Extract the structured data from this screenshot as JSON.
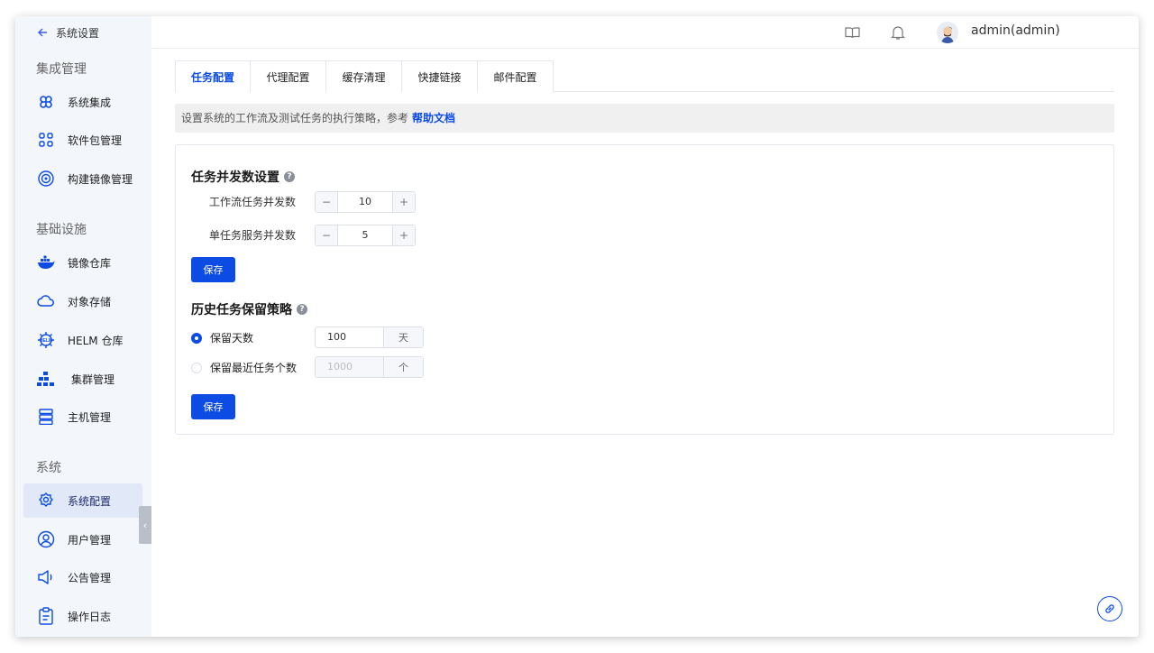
{
  "sidebar": {
    "back_label": "系统设置",
    "groups": [
      {
        "title": "集成管理",
        "items": [
          {
            "label": "系统集成",
            "icon": "command-icon"
          },
          {
            "label": "软件包管理",
            "icon": "grid-icon"
          },
          {
            "label": "构建镜像管理",
            "icon": "target-icon"
          }
        ]
      },
      {
        "title": "基础设施",
        "items": [
          {
            "label": "镜像仓库",
            "icon": "docker-icon"
          },
          {
            "label": "对象存储",
            "icon": "cloud-icon"
          },
          {
            "label": "HELM 仓库",
            "icon": "helm-icon"
          },
          {
            "label": "集群管理",
            "icon": "cluster-icon"
          },
          {
            "label": "主机管理",
            "icon": "server-icon"
          }
        ]
      },
      {
        "title": "系统",
        "items": [
          {
            "label": "系统配置",
            "icon": "settings-icon",
            "active": true
          },
          {
            "label": "用户管理",
            "icon": "user-icon"
          },
          {
            "label": "公告管理",
            "icon": "speaker-icon"
          },
          {
            "label": "操作日志",
            "icon": "clipboard-icon"
          }
        ]
      }
    ]
  },
  "header": {
    "username": "admin(admin)"
  },
  "tabs": [
    {
      "label": "任务配置",
      "active": true
    },
    {
      "label": "代理配置"
    },
    {
      "label": "缓存清理"
    },
    {
      "label": "快捷链接"
    },
    {
      "label": "邮件配置"
    }
  ],
  "info": {
    "text": "设置系统的工作流及测试任务的执行策略，参考",
    "link": "帮助文档"
  },
  "concurrency": {
    "title": "任务并发数设置",
    "workflow_label": "工作流任务并发数",
    "workflow_value": "10",
    "service_label": "单任务服务并发数",
    "service_value": "5",
    "save_label": "保存"
  },
  "retention": {
    "title": "历史任务保留策略",
    "days_label": "保留天数",
    "days_value": "100",
    "days_unit": "天",
    "count_label": "保留最近任务个数",
    "count_value": "1000",
    "count_unit": "个",
    "save_label": "保存"
  },
  "colors": {
    "primary": "#0c4ce5",
    "sidebar_bg": "#f3f6fb",
    "active_item_bg": "#e1e9f9"
  }
}
